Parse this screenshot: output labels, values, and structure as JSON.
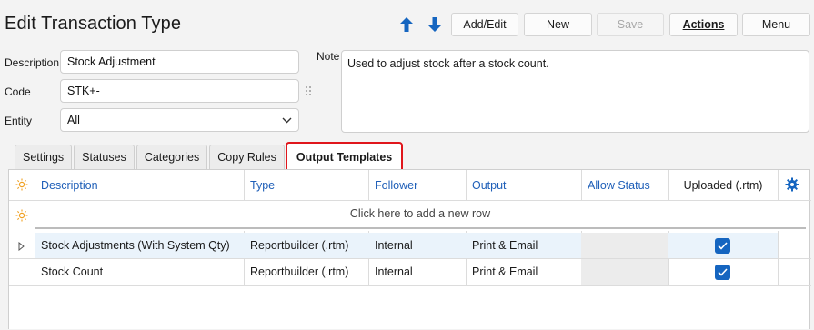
{
  "page": {
    "title": "Edit Transaction Type"
  },
  "toolbar": {
    "up_icon": "arrow-up-icon",
    "down_icon": "arrow-down-icon",
    "add_edit": "Add/Edit",
    "new": "New",
    "save": "Save",
    "actions": "Actions",
    "menu": "Menu"
  },
  "form": {
    "description_label": "Description",
    "description_value": "Stock Adjustment",
    "code_label": "Code",
    "code_value": "STK+-",
    "entity_label": "Entity",
    "entity_value": "All",
    "note_label": "Note",
    "note_value": "Used to adjust stock after a stock count."
  },
  "tabs": [
    "Settings",
    "Statuses",
    "Categories",
    "Copy Rules",
    "Output Templates"
  ],
  "grid": {
    "columns": [
      "Description",
      "Type",
      "Follower",
      "Output",
      "Allow Status",
      "Uploaded (.rtm)"
    ],
    "new_row_text": "Click here to add a new row",
    "rows": [
      {
        "description": "Stock Adjustments (With System Qty)",
        "type": "Reportbuilder (.rtm)",
        "follower": "Internal",
        "output": "Print & Email",
        "allow_status": "",
        "uploaded": true
      },
      {
        "description": "Stock Count",
        "type": "Reportbuilder (.rtm)",
        "follower": "Internal",
        "output": "Print & Email",
        "allow_status": "",
        "uploaded": true
      }
    ]
  },
  "colors": {
    "accent": "#1565c0",
    "link": "#1f5fb8",
    "highlight": "#e0161c",
    "selected_row": "#eaf3fb",
    "sun_icon": "#f0a020"
  }
}
